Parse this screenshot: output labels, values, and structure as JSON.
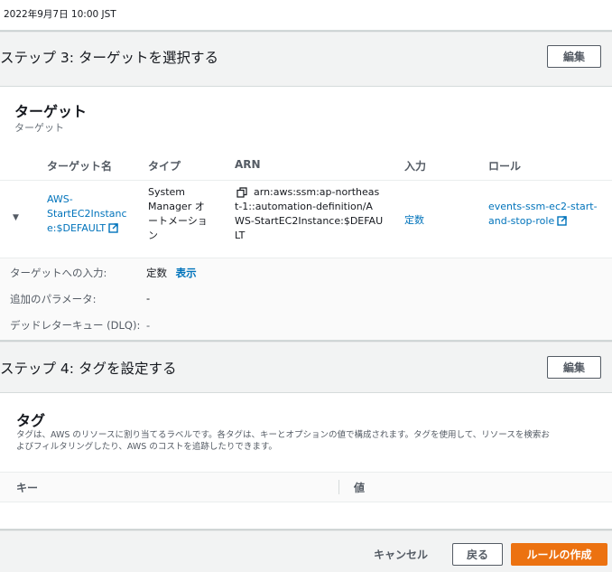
{
  "schedule": {
    "timestamp": "2022年9月7日 10:00 JST"
  },
  "step3": {
    "title": "ステップ 3: ターゲットを選択する",
    "edit_label": "編集",
    "section_title": "ターゲット",
    "section_subtitle": "ターゲット",
    "columns": [
      "ターゲット名",
      "タイプ",
      "ARN",
      "入力",
      "ロール"
    ],
    "row": {
      "name": "AWS-StartEC2Instance:$DEFAULT",
      "name_lines": [
        "AWS-",
        "StartEC2Instanc",
        "e:$DEFAULT"
      ],
      "type_lines": [
        "System",
        "Manager オ",
        "ートメーショ",
        "ン"
      ],
      "arn_lines": [
        "arn:aws:ssm:ap-northeas",
        "t-1::automation-definition/A",
        "WS-StartEC2Instance:$DEFAU",
        "LT"
      ],
      "input": "定数",
      "role_lines": [
        "events-ssm-ec2-start-",
        "and-stop-role"
      ]
    },
    "details": {
      "input_label": "ターゲットへの入力:",
      "input_value": "定数",
      "input_show_link": "表示",
      "params_label": "追加のパラメータ:",
      "params_value": "-",
      "dlq_label": "デッドレターキュー (DLQ):",
      "dlq_value": "-"
    }
  },
  "step4": {
    "title": "ステップ 4: タグを設定する",
    "edit_label": "編集",
    "section_title": "タグ",
    "description_line1": "タグは、AWS のリソースに割り当てるラベルです。各タグは、キーとオプションの値で構成されます。タグを使用して、リソースを検索お",
    "description_line2": "よびフィルタリングしたり、AWS のコストを追跡したりできます。",
    "columns": [
      "キー",
      "値"
    ]
  },
  "footer": {
    "cancel_label": "キャンセル",
    "back_label": "戻る",
    "create_label": "ルールの作成"
  },
  "colors": {
    "link": "#0073bb",
    "primary": "#ec7211",
    "border": "#d5dbdb"
  }
}
